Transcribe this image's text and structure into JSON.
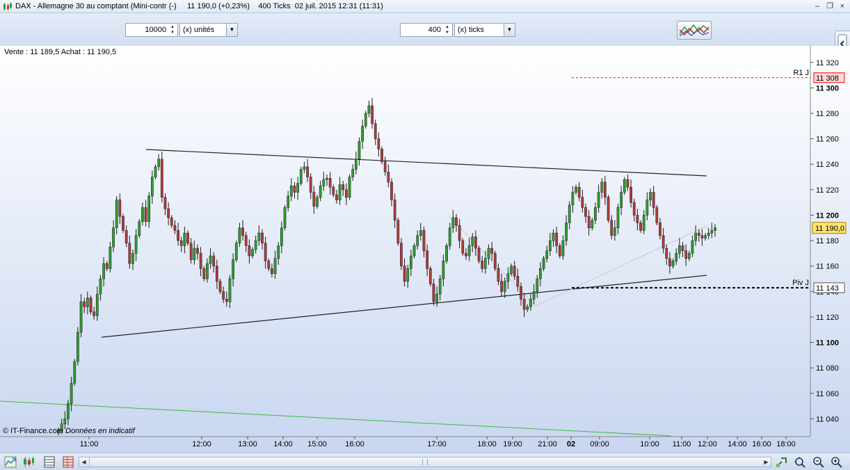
{
  "window": {
    "title": "DAX - Allemagne 30 au comptant (Mini-contr (-)     11 190,0 (+0,23%)    400 Ticks  02 juil. 2015 12:31 (11:31)",
    "minimize_label": "–",
    "restore_label": "❐",
    "close_label": "×"
  },
  "toolbar": {
    "quantity_value": "10000",
    "quantity_unit": "(x) unités",
    "ticks_value": "400",
    "ticks_unit": "(x) ticks",
    "spin_up": "▲",
    "spin_down": "▼",
    "dropdown_arrow": "▼"
  },
  "chart_info": {
    "quote": "Vente : 11 189,5 Achat : 11 190,5",
    "copyright_prefix": "© IT-Finance.com ",
    "copyright_note": "Données en indicatif"
  },
  "icons": {
    "app": "candlestick-app-icon",
    "indicators_button": "multi-indicator-icon",
    "side_handle": "panel-toggle-icon",
    "bottom_left": [
      "chart-type-icon",
      "candle-style-icon",
      "grid-icon",
      "layout-icon"
    ],
    "bottom_right": [
      "zoom-fit-icon",
      "zoom-cursor-icon",
      "zoom-out-icon",
      "zoom-in-icon",
      "back-icon"
    ]
  },
  "colors": {
    "background_top": "#ffffff",
    "background_bottom": "#c8d6f0",
    "candle_up": "#2f9e2f",
    "candle_down": "#b23a3a",
    "resistance": "#ff0000",
    "support_line_green": "#3cba3c",
    "last_price_bg": "#ffe36b"
  },
  "chart_data": {
    "type": "candlestick",
    "yticks": [
      11040,
      11060,
      11080,
      11100,
      11120,
      11140,
      11160,
      11180,
      11200,
      11220,
      11240,
      11260,
      11280,
      11300,
      11320
    ],
    "ytick_labels": [
      "11 040",
      "11 060",
      "11 080",
      "11 100",
      "11 120",
      "11 140",
      "11 160",
      "11 180",
      "11 200",
      "11 220",
      "11 240",
      "11 260",
      "11 280",
      "11 300",
      "11 320"
    ],
    "bold_ticks": [
      "11 100",
      "11 200",
      "11 300"
    ],
    "xtick_labels": [
      "11:00",
      "12:00",
      "13:00",
      "14:00",
      "15:00",
      "16:00",
      "17:00",
      "18:00",
      "19:00",
      "21:00",
      "02",
      "09:00",
      "10:00",
      "11:00",
      "12:00",
      "14:00",
      "16:00",
      "18:00"
    ],
    "ylim": [
      11026,
      11333
    ],
    "levels": [
      {
        "label": "R1 J",
        "value": 11308,
        "price_label": "11 308",
        "style": "dashed-red"
      },
      {
        "label": "Piv J",
        "value": 11143,
        "price_label": "11 143",
        "style": "dashed-black"
      }
    ],
    "last_price": {
      "value": 11190,
      "label": "11 190,0"
    },
    "close_path": [
      11031,
      11036,
      11040,
      11052,
      11068,
      11085,
      11108,
      11132,
      11128,
      11135,
      11124,
      11121,
      11138,
      11150,
      11162,
      11158,
      11175,
      11190,
      11212,
      11199,
      11188,
      11178,
      11162,
      11170,
      11184,
      11195,
      11206,
      11195,
      11215,
      11230,
      11238,
      11244,
      11214,
      11205,
      11198,
      11192,
      11188,
      11180,
      11176,
      11186,
      11178,
      11165,
      11174,
      11170,
      11158,
      11150,
      11162,
      11168,
      11160,
      11148,
      11140,
      11134,
      11132,
      11150,
      11165,
      11178,
      11190,
      11184,
      11176,
      11168,
      11173,
      11180,
      11186,
      11178,
      11164,
      11158,
      11154,
      11166,
      11176,
      11190,
      11206,
      11215,
      11223,
      11218,
      11225,
      11236,
      11238,
      11230,
      11218,
      11207,
      11214,
      11223,
      11228,
      11229,
      11222,
      11216,
      11212,
      11224,
      11220,
      11214,
      11230,
      11236,
      11244,
      11258,
      11270,
      11280,
      11286,
      11272,
      11260,
      11252,
      11242,
      11234,
      11226,
      11212,
      11196,
      11178,
      11160,
      11148,
      11158,
      11168,
      11176,
      11184,
      11188,
      11172,
      11158,
      11146,
      11132,
      11138,
      11150,
      11164,
      11176,
      11190,
      11198,
      11192,
      11180,
      11170,
      11168,
      11176,
      11183,
      11174,
      11164,
      11158,
      11166,
      11174,
      11170,
      11158,
      11148,
      11140,
      11148,
      11154,
      11160,
      11152,
      11144,
      11134,
      11126,
      11128,
      11134,
      11140,
      11150,
      11158,
      11166,
      11172,
      11180,
      11186,
      11176,
      11168,
      11180,
      11194,
      11208,
      11218,
      11222,
      11214,
      11206,
      11199,
      11190,
      11196,
      11206,
      11218,
      11226,
      11214,
      11196,
      11184,
      11190,
      11206,
      11218,
      11228,
      11222,
      11210,
      11200,
      11194,
      11188,
      11200,
      11212,
      11218,
      11206,
      11194,
      11184,
      11174,
      11166,
      11160,
      11164,
      11170,
      11176,
      11172,
      11166,
      11170,
      11180,
      11186,
      11184,
      11182,
      11184,
      11186,
      11188,
      11190
    ]
  }
}
